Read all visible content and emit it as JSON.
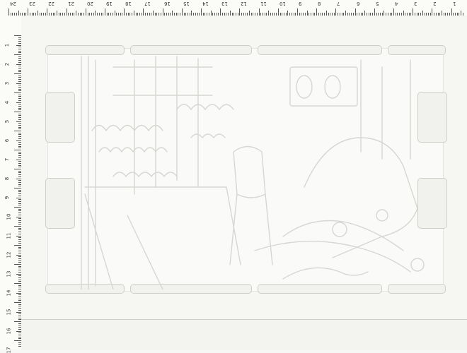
{
  "ruler_top": {
    "numbers": [
      "24",
      "23",
      "22",
      "21",
      "20",
      "19",
      "18",
      "17",
      "16",
      "15",
      "14",
      "13",
      "12",
      "11",
      "10",
      "9",
      "8",
      "7",
      "6",
      "5",
      "4",
      "3",
      "2",
      "1"
    ]
  },
  "ruler_left": {
    "numbers": [
      "1",
      "2",
      "3",
      "4",
      "5",
      "6",
      "7",
      "8",
      "9",
      "10",
      "11",
      "12",
      "13",
      "14",
      "15",
      "16",
      "17"
    ]
  },
  "artwork": {
    "subject": "embossed-interior-scene",
    "colors": {
      "paper": "#fafaf9",
      "emboss_shadow": "#d8d8d4",
      "emboss_light": "#ffffff"
    }
  }
}
